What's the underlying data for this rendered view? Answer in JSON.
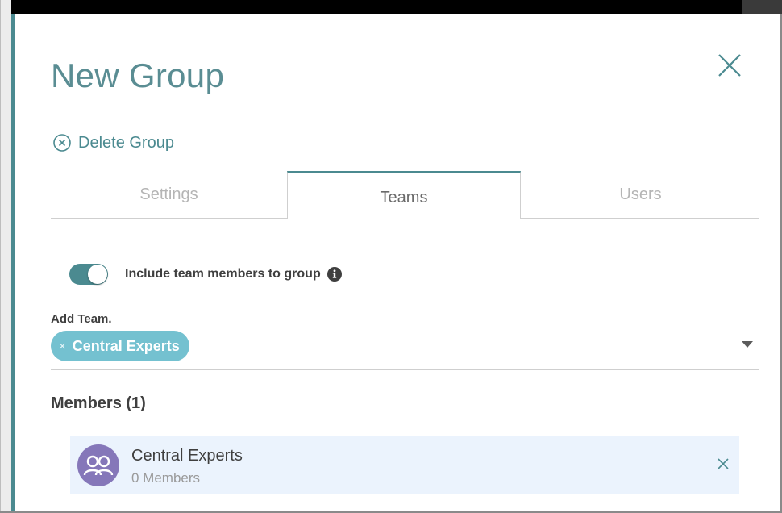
{
  "dialog": {
    "title": "New Group",
    "delete_label": "Delete Group"
  },
  "tabs": [
    {
      "label": "Settings",
      "active": false
    },
    {
      "label": "Teams",
      "active": true
    },
    {
      "label": "Users",
      "active": false
    }
  ],
  "teams_panel": {
    "toggle_label": "Include team members to group",
    "toggle_on": true,
    "add_team_label": "Add Team.",
    "selected_chip": "Central Experts",
    "chip_remove_glyph": "×",
    "members_title": "Members (1)",
    "members": [
      {
        "name": "Central Experts",
        "count_text": "0 Members",
        "avatar_icon": "group-icon"
      }
    ]
  },
  "icons": {
    "close": "close-icon",
    "delete": "circle-x-icon",
    "info": "info-icon",
    "dropdown": "caret-down-icon",
    "remove": "close-icon"
  },
  "colors": {
    "accent": "#4b8a90",
    "title": "#5a8d93",
    "chip": "#74c1d0",
    "avatar": "#8577b9",
    "row_highlight": "#ebf3fd"
  }
}
